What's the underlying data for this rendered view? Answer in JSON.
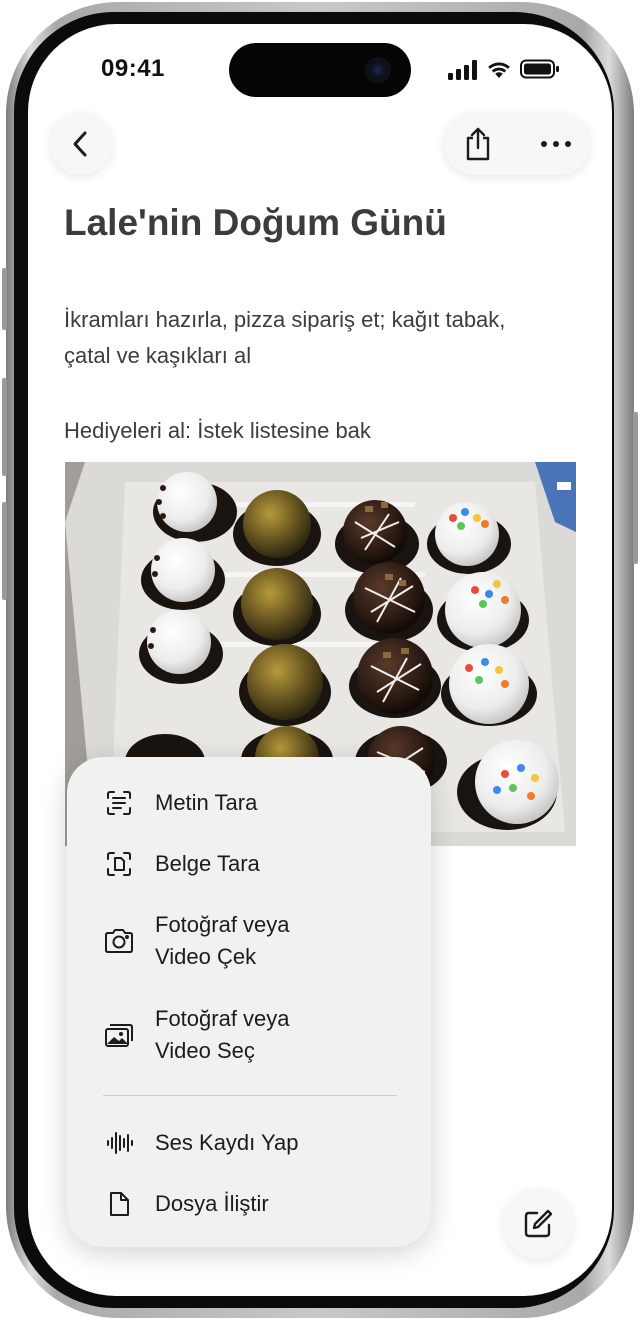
{
  "status_bar": {
    "time": "09:41",
    "icons": [
      "signal-icon",
      "wifi-icon",
      "battery-icon"
    ]
  },
  "toolbar": {
    "back_icon": "chevron-left-icon",
    "share_icon": "share-icon",
    "more_icon": "ellipsis-icon"
  },
  "note": {
    "title": "Lale'nin Doğum Günü",
    "body_lines": [
      "İkramları hazırla, pizza sipariş et; kağıt tabak,",
      "çatal ve kaşıkları al"
    ],
    "gifts": "Hediyeleri al: İstek listesine bak",
    "photo_description": "cake-pops-photo"
  },
  "attachment_menu": {
    "items": [
      {
        "label": "Metin Tara",
        "icon": "scan-text-icon"
      },
      {
        "label": "Belge Tara",
        "icon": "scan-document-icon"
      },
      {
        "label_line1": "Fotoğraf veya",
        "label_line2": "Video Çek",
        "icon": "camera-icon"
      },
      {
        "label_line1": "Fotoğraf veya",
        "label_line2": "Video Seç",
        "icon": "photo-library-icon"
      },
      {
        "label": "Ses Kaydı Yap",
        "icon": "waveform-icon"
      },
      {
        "label": "Dosya İliştir",
        "icon": "document-icon"
      }
    ]
  },
  "compose_icon": "compose-icon",
  "colors": {
    "menu_background": "#f1f1f1",
    "text": "#3c3c3c",
    "frame": "#0b0b0b"
  }
}
